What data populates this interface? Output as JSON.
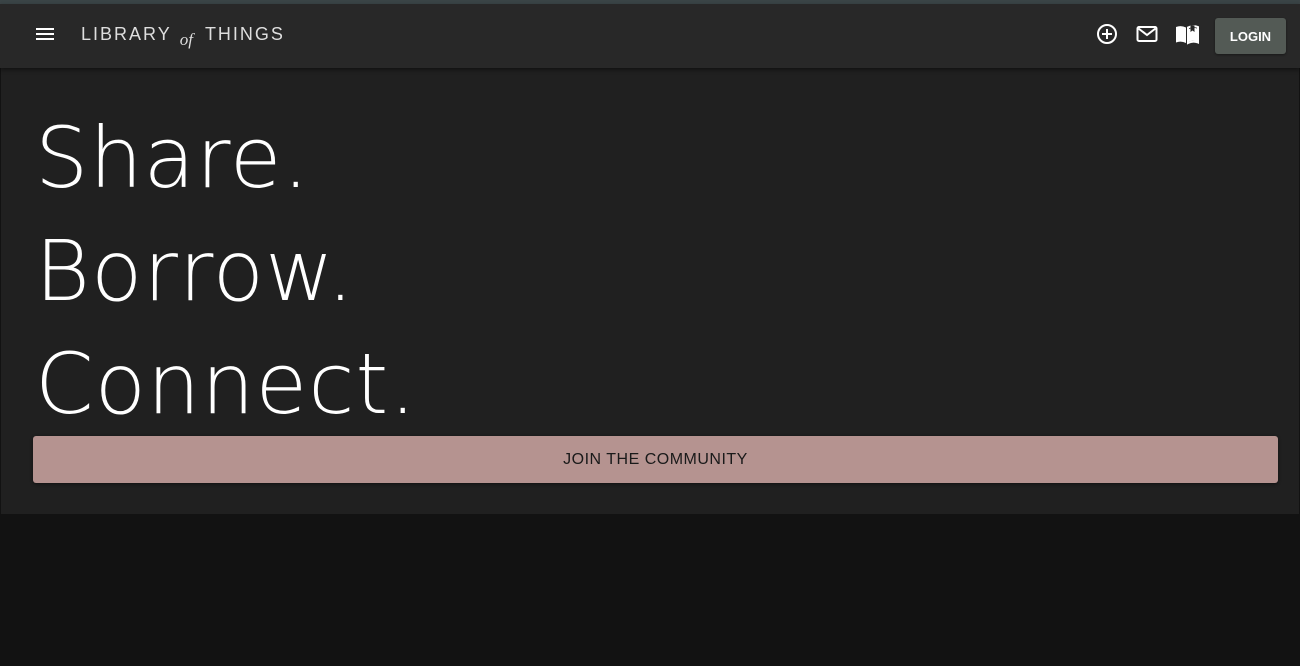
{
  "header": {
    "brand": {
      "part1": "LIBRARY",
      "part2": "of",
      "part3": "THINGS"
    },
    "icons": {
      "menu": "menu-icon",
      "add": "add-circle-icon",
      "messages": "mail-icon",
      "library": "book-icon"
    },
    "login_label": "LOGIN"
  },
  "hero": {
    "lines": [
      "Share.",
      "Borrow.",
      "Connect."
    ],
    "cta_label": "JOIN THE COMMUNITY"
  },
  "colors": {
    "navbar": "#282828",
    "hero": "#202020",
    "page": "#121212",
    "login_button": "#535a55",
    "cta_button": "#b59390"
  }
}
